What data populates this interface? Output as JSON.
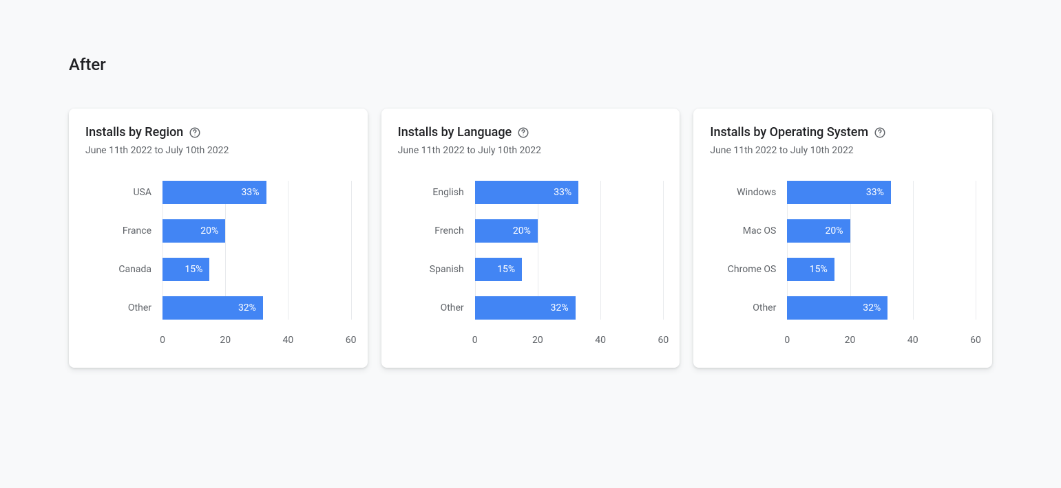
{
  "page_heading": "After",
  "date_range": "June 11th 2022 to July 10th 2022",
  "axis_max": 60,
  "ticks": [
    0,
    20,
    40,
    60
  ],
  "bar_color": "#4285f4",
  "chart_data": [
    {
      "type": "bar",
      "title": "Installs by Region",
      "categories": [
        "USA",
        "France",
        "Canada",
        "Other"
      ],
      "values": [
        33,
        20,
        15,
        32
      ],
      "value_labels": [
        "33%",
        "20%",
        "15%",
        "32%"
      ],
      "xlabel": "",
      "ylabel": "",
      "xlim": [
        0,
        60
      ]
    },
    {
      "type": "bar",
      "title": "Installs by Language",
      "categories": [
        "English",
        "French",
        "Spanish",
        "Other"
      ],
      "values": [
        33,
        20,
        15,
        32
      ],
      "value_labels": [
        "33%",
        "20%",
        "15%",
        "32%"
      ],
      "xlabel": "",
      "ylabel": "",
      "xlim": [
        0,
        60
      ]
    },
    {
      "type": "bar",
      "title": "Installs by Operating System",
      "categories": [
        "Windows",
        "Mac OS",
        "Chrome OS",
        "Other"
      ],
      "values": [
        33,
        20,
        15,
        32
      ],
      "value_labels": [
        "33%",
        "20%",
        "15%",
        "32%"
      ],
      "xlabel": "",
      "ylabel": "",
      "xlim": [
        0,
        60
      ]
    }
  ]
}
